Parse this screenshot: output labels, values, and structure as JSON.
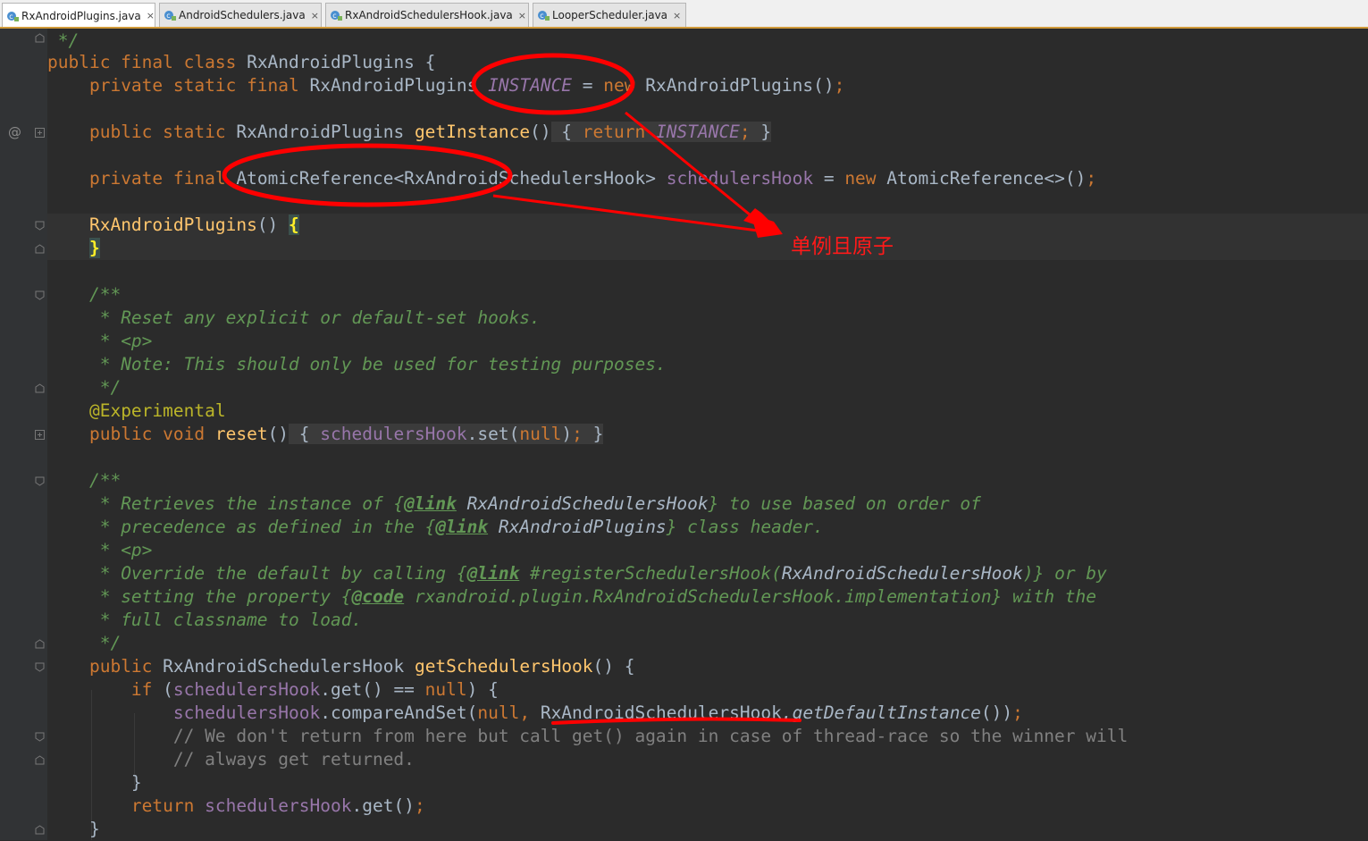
{
  "tabs": [
    {
      "label": "RxAndroidPlugins.java",
      "active": true
    },
    {
      "label": "AndroidSchedulers.java",
      "active": false
    },
    {
      "label": "RxAndroidSchedulersHook.java",
      "active": false
    },
    {
      "label": "LooperScheduler.java",
      "active": false
    }
  ],
  "close_glyph": "×",
  "annotation_note": "单例且原子",
  "code": {
    "l0": " */",
    "class_decl": {
      "kw": "public final class",
      "name": "RxAndroidPlugins",
      "tail": " {"
    },
    "instance": {
      "kw1": "private static final",
      "type": "RxAndroidPlugins",
      "field": "INSTANCE",
      "eq": " = ",
      "kw2": "new",
      "ctor": "RxAndroidPlugins()",
      "semi": ";"
    },
    "getinstance": {
      "kw": "public static",
      "type": "RxAndroidPlugins",
      "name": "getInstance",
      "parens": "()",
      "ob": " { ",
      "ret": "return",
      "field": "INSTANCE",
      "semi": ";",
      "cb": " }"
    },
    "hookfield": {
      "kw": "private final",
      "type": "AtomicReference<RxAndroidSchedulersHook>",
      "field": "schedulersHook",
      "eq": " = ",
      "kw2": "new",
      "ctor": "AtomicReference<>()",
      "semi": ";"
    },
    "ctor": {
      "name": "RxAndroidPlugins",
      "parens": "() ",
      "ob": "{"
    },
    "ctor_close": "}",
    "doc1": [
      "/**",
      " * Reset any explicit or default-set hooks.",
      " * <p>",
      " * Note: This should only be used for testing purposes.",
      " */"
    ],
    "annotation": "@Experimental",
    "reset": {
      "kw": "public void",
      "name": "reset",
      "parens": "()",
      "ob": " { ",
      "field": "schedulersHook",
      "call": ".set(",
      "nul": "null",
      "close": ")",
      "semi": ";",
      "cb": " }"
    },
    "doc2_open": "/**",
    "doc2_l1": {
      "a": " * Retrieves the instance of {",
      "tag": "@link",
      "ref": " RxAndroidSchedulersHook",
      "b": "} to use based on order of"
    },
    "doc2_l2": {
      "a": " * precedence as defined in the {",
      "tag": "@link",
      "ref": " RxAndroidPlugins",
      "b": "} class header."
    },
    "doc2_l3": " * <p>",
    "doc2_l4": {
      "a": " * Override the default by calling {",
      "tag": "@link",
      "ref1": " #registerSchedulersHook(",
      "ref2": "RxAndroidSchedulersHook",
      "ref3": ")",
      "b": "} or by"
    },
    "doc2_l5": {
      "a": " * setting the property {",
      "tag": "@code",
      "ref": " rxandroid.plugin.RxAndroidSchedulersHook.implementation",
      "b": "} with the"
    },
    "doc2_l6": " * full classname to load.",
    "doc2_close": " */",
    "gethook": {
      "kw": "public",
      "type": "RxAndroidSchedulersHook",
      "name": "getSchedulersHook",
      "tail": "() {"
    },
    "if_line": {
      "kw": "if",
      "a": " (",
      "field": "schedulersHook",
      "b": ".get() == ",
      "nul": "null",
      "c": ") {"
    },
    "cas_line": {
      "field": "schedulersHook",
      "a": ".compareAndSet(",
      "nul": "null",
      "comma": ", ",
      "type": "RxAndroidSchedulersHook",
      "call": ".getDefaultInstance",
      "c": "())",
      "semi": ";"
    },
    "comment1": "// We don't return from here but call get() again in case of thread-race so the winner will",
    "comment2": "// always get returned.",
    "if_close": "}",
    "ret_line": {
      "kw": "return",
      "field": " schedulersHook",
      "a": ".get()",
      "semi": ";"
    },
    "method_close": "}"
  },
  "colors": {
    "background": "#2b2b2b",
    "keyword": "#cc7832",
    "function": "#ffc66d",
    "field": "#9876aa",
    "comment_doc": "#629755",
    "comment_line": "#808080",
    "default_text": "#a9b7c6",
    "annotation": "#bbb529",
    "markup_red": "#ff0000"
  }
}
